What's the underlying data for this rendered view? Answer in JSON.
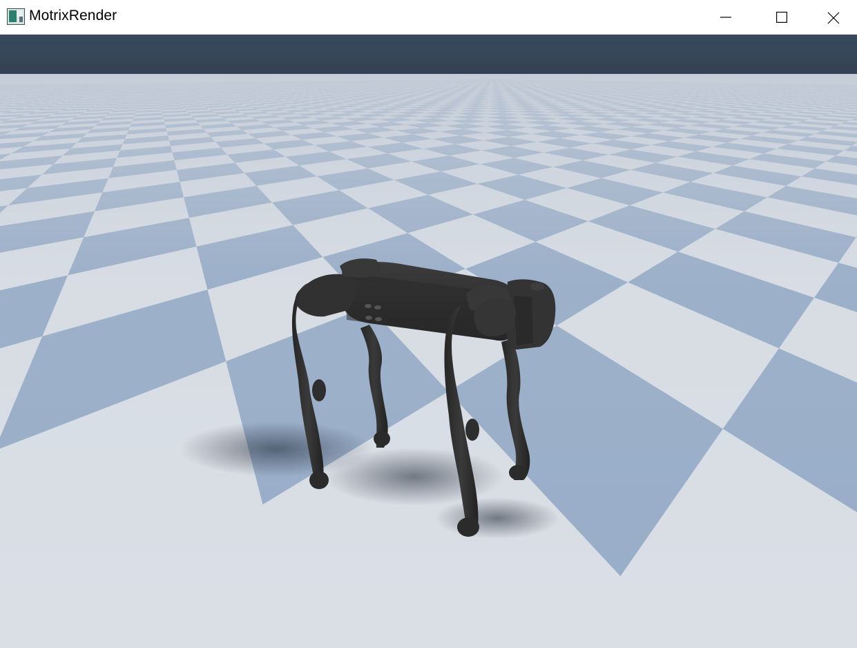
{
  "window": {
    "title": "MotrixRender",
    "icon": "app-window-icon",
    "controls": [
      {
        "name": "minimize",
        "icon": "minimize-icon"
      },
      {
        "name": "maximize",
        "icon": "maximize-icon"
      },
      {
        "name": "close",
        "icon": "close-icon"
      }
    ]
  },
  "scene": {
    "sky_color": "#36465a",
    "floor_light_color": "#dadfe6",
    "floor_dark_color": "#98adc8",
    "robot_color": "#2f2f2f",
    "object": "quadruped-robot"
  }
}
